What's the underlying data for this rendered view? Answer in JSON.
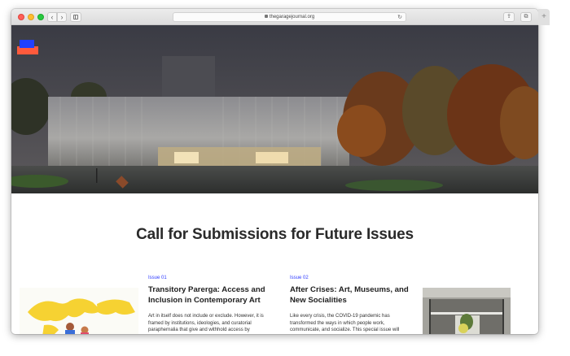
{
  "browser": {
    "url": "thegaragejournal.org",
    "new_tab_symbol": "+"
  },
  "page": {
    "title": "Call for Submissions for Future Issues"
  },
  "issues": [
    {
      "label": "Issue 01",
      "title": "Transitory Parerga: Access and Inclusion in Contemporary Art",
      "text": "Art in itself does not include or exclude. However, it is framed by institutions, ideologies, and curatorial paraphernalia that give and withhold access by centralizing contemporary art in Eurocentric urban"
    },
    {
      "label": "Issue 02",
      "title": "After Crises: Art, Museums, and New Socialities",
      "text": "Like every crisis, the COVID-19 pandemic has transformed the ways in which people work, communicate, and socialize. This special issue will explore the ways in which crises of all kinds—global"
    }
  ],
  "colors": {
    "accent": "#2f3bff",
    "logo_blue": "#2040ff",
    "logo_red": "#ff5a3c"
  }
}
